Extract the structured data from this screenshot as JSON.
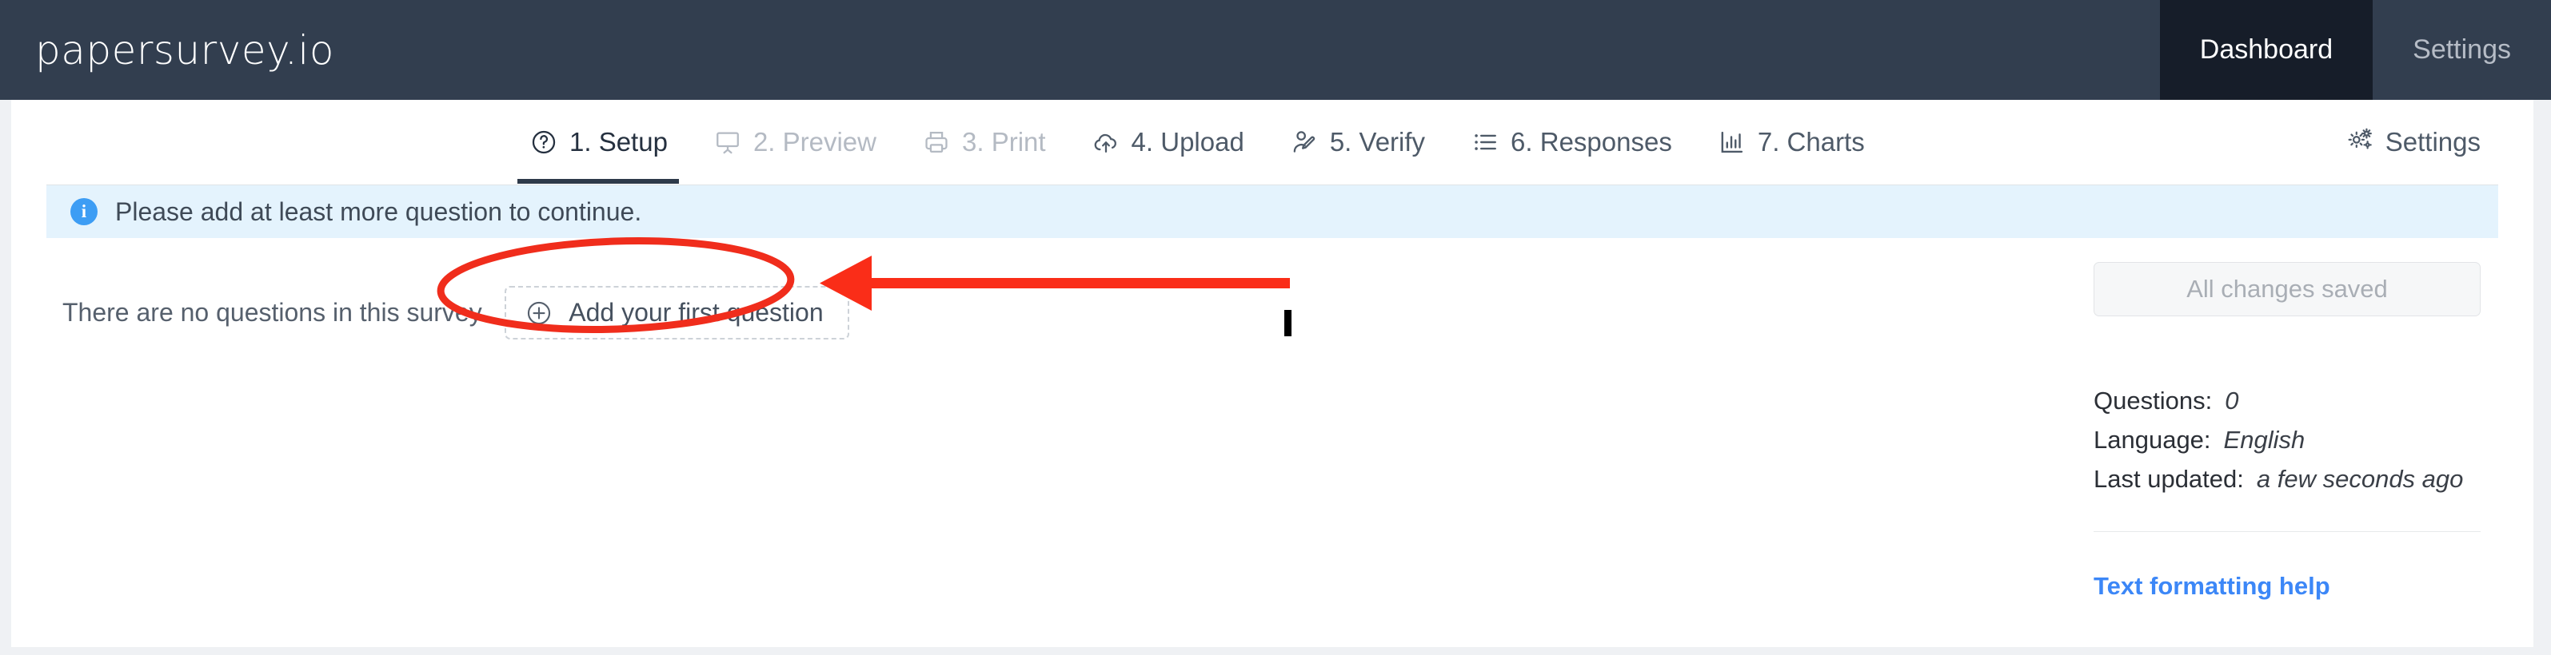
{
  "brand": {
    "name": "papersurvey.io"
  },
  "topnav": {
    "items": [
      {
        "label": "Dashboard",
        "active": true
      },
      {
        "label": "Settings",
        "active": false
      }
    ]
  },
  "tabs": [
    {
      "label": "1. Setup",
      "icon": "question-circle-icon",
      "state": "active"
    },
    {
      "label": "2. Preview",
      "icon": "presentation-icon",
      "state": "disabled"
    },
    {
      "label": "3. Print",
      "icon": "printer-icon",
      "state": "disabled"
    },
    {
      "label": "4. Upload",
      "icon": "cloud-upload-icon",
      "state": "enabled"
    },
    {
      "label": "5. Verify",
      "icon": "user-edit-icon",
      "state": "enabled"
    },
    {
      "label": "6. Responses",
      "icon": "list-icon",
      "state": "enabled"
    },
    {
      "label": "7. Charts",
      "icon": "bar-chart-icon",
      "state": "enabled"
    }
  ],
  "settings_tab": {
    "label": "Settings",
    "icon": "gears-icon"
  },
  "alert": {
    "icon": "info-icon",
    "icon_glyph": "i",
    "message": "Please add at least more question to continue.",
    "background_color": "#e4f3fd",
    "icon_color": "#3d9df4"
  },
  "empty_state": {
    "message": "There are no questions in this survey.",
    "add_button_label": "Add your first question",
    "add_button_icon": "plus-circle-icon"
  },
  "sidebar": {
    "save_state_label": "All changes saved",
    "meta": [
      {
        "label": "Questions:",
        "value": "0"
      },
      {
        "label": "Language:",
        "value": "English"
      },
      {
        "label": "Last updated:",
        "value": "a few seconds ago"
      }
    ],
    "help_link_label": "Text formatting help",
    "help_link_color": "#3c87f7"
  },
  "annotations": {
    "ellipse": {
      "color": "#f02d1c",
      "target": "add-your-first-question-button"
    },
    "arrow": {
      "color": "#fa2d18",
      "direction": "left",
      "points_to": "add-your-first-question-button"
    },
    "text_caret": {
      "color": "#000000"
    }
  },
  "theme": {
    "header_bg": "#323e4f",
    "header_active_bg": "#161d29",
    "page_bg": "#eff1f4",
    "surface": "#ffffff",
    "active_tab_underline": "#2e3a4a"
  }
}
